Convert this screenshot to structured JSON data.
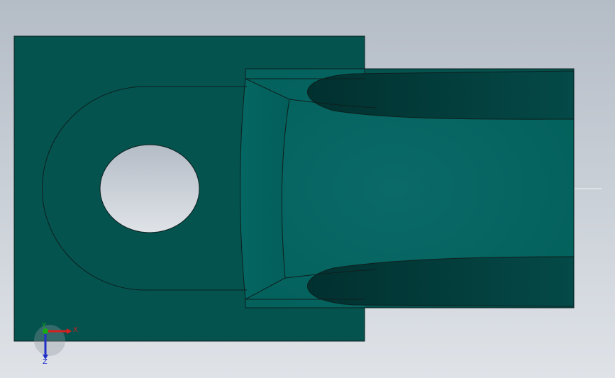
{
  "viewport": {
    "background_top": "#b4bcc6",
    "background_bottom": "#dfe3e8"
  },
  "model": {
    "body_color": "#04534f",
    "face_color": "#03605b",
    "shaft_highlight": "#0a6a68",
    "shaft_shadow": "#02403f",
    "edge_color": "#0d1f1e"
  },
  "triad": {
    "x_label": "X",
    "y_label": "Y",
    "z_label": "Z",
    "x_color": "#d62020",
    "y_color": "#18a818",
    "z_color": "#2030c8"
  }
}
